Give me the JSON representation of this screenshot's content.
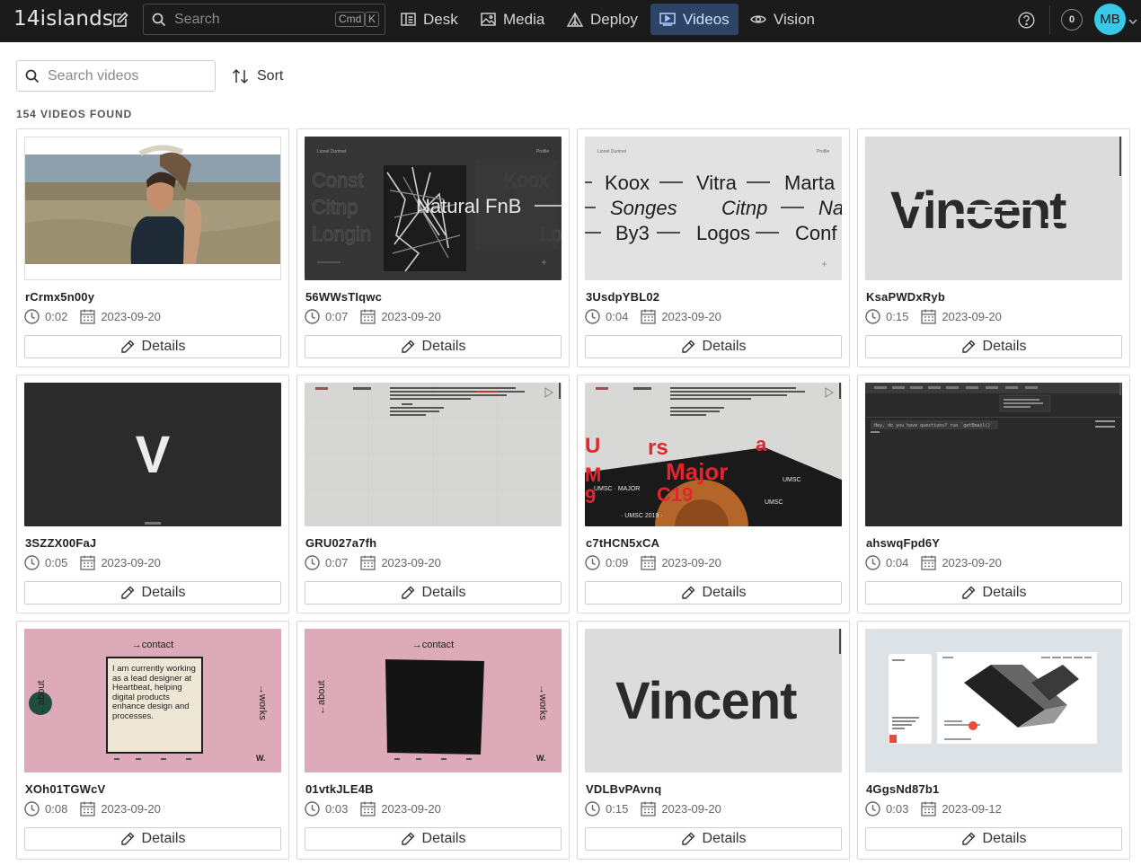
{
  "app": {
    "brand": "14islands"
  },
  "search": {
    "placeholder": "Search",
    "kbd_mod": "Cmd",
    "kbd_key": "K"
  },
  "nav": [
    {
      "label": "Desk",
      "icon": "desk-icon",
      "active": false
    },
    {
      "label": "Media",
      "icon": "media-icon",
      "active": false
    },
    {
      "label": "Deploy",
      "icon": "deploy-icon",
      "active": false
    },
    {
      "label": "Videos",
      "icon": "videos-icon",
      "active": true
    },
    {
      "label": "Vision",
      "icon": "vision-icon",
      "active": false
    }
  ],
  "user": {
    "notifications": "0",
    "initials": "MB"
  },
  "toolbar": {
    "search_placeholder": "Search videos",
    "sort_label": "Sort"
  },
  "results": {
    "count_label": "154 VIDEOS FOUND"
  },
  "details_label": "Details",
  "colors": {
    "topbar": "#1b1b1b",
    "active_nav": "#2d4466",
    "avatar": "#38c9e8"
  },
  "videos": [
    {
      "id": "rCrmx5n00y",
      "duration": "0:02",
      "date": "2023-09-20",
      "thumb": "beach-photo"
    },
    {
      "id": "56WWsTIqwc",
      "duration": "0:07",
      "date": "2023-09-20",
      "thumb": "dark-list",
      "thumb_text": "Natural FnB"
    },
    {
      "id": "3UsdpYBL02",
      "duration": "0:04",
      "date": "2023-09-20",
      "thumb": "light-list",
      "words": [
        "Koox",
        "Vitra",
        "Marta",
        "Songes",
        "Citnp",
        "Na",
        "By3",
        "Logos",
        "Conf"
      ]
    },
    {
      "id": "KsaPWDxRyb",
      "duration": "0:15",
      "date": "2023-09-20",
      "thumb": "glitch-title",
      "thumb_text": "Vincent"
    },
    {
      "id": "3SZZX00FaJ",
      "duration": "0:05",
      "date": "2023-09-20",
      "thumb": "dark-v",
      "thumb_text": "V"
    },
    {
      "id": "GRU027a7fh",
      "duration": "0:07",
      "date": "2023-09-20",
      "thumb": "grey-about"
    },
    {
      "id": "c7tHCN5xCA",
      "duration": "0:09",
      "date": "2023-09-20",
      "thumb": "red-typography"
    },
    {
      "id": "ahswqFpd6Y",
      "duration": "0:04",
      "date": "2023-09-20",
      "thumb": "terminal"
    },
    {
      "id": "XOh01TGWcV",
      "duration": "0:08",
      "date": "2023-09-20",
      "thumb": "pink-contact-text",
      "thumb_contact": "→contact",
      "thumb_about": "←about",
      "thumb_works": "→works",
      "thumb_body": "I am currently working as a lead designer at Heartbeat, helping digital products enhance design and processes."
    },
    {
      "id": "01vtkJLE4B",
      "duration": "0:03",
      "date": "2023-09-20",
      "thumb": "pink-contact-black",
      "thumb_contact": "→contact",
      "thumb_about": "←about",
      "thumb_works": "→works"
    },
    {
      "id": "VDLBvPAvnq",
      "duration": "0:15",
      "date": "2023-09-20",
      "thumb": "grey-title",
      "thumb_text": "Vincent"
    },
    {
      "id": "4GgsNd87b1",
      "duration": "0:03",
      "date": "2023-09-12",
      "thumb": "phone-mockup"
    }
  ]
}
